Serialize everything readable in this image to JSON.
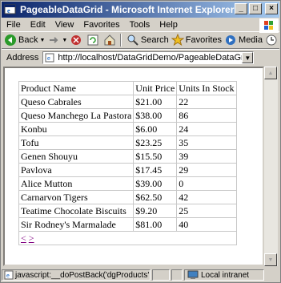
{
  "window": {
    "title": "PageableDataGrid - Microsoft Internet Explorer"
  },
  "menu": [
    "File",
    "Edit",
    "View",
    "Favorites",
    "Tools",
    "Help"
  ],
  "menu_accel": [
    "F",
    "E",
    "V",
    "a",
    "T",
    "H"
  ],
  "toolbar": {
    "back": "Back",
    "search": "Search",
    "favorites": "Favorites",
    "media": "Media"
  },
  "address": {
    "label": "Address",
    "url": "http://localhost/DataGridDemo/PageableDataGrid.aspx"
  },
  "grid": {
    "headers": [
      "Product Name",
      "Unit Price",
      "Units In Stock"
    ],
    "rows": [
      [
        "Queso Cabrales",
        "$21.00",
        "22"
      ],
      [
        "Queso Manchego La Pastora",
        "$38.00",
        "86"
      ],
      [
        "Konbu",
        "$6.00",
        "24"
      ],
      [
        "Tofu",
        "$23.25",
        "35"
      ],
      [
        "Genen Shouyu",
        "$15.50",
        "39"
      ],
      [
        "Pavlova",
        "$17.45",
        "29"
      ],
      [
        "Alice Mutton",
        "$39.00",
        "0"
      ],
      [
        "Carnarvon Tigers",
        "$62.50",
        "42"
      ],
      [
        "Teatime Chocolate Biscuits",
        "$9.20",
        "25"
      ],
      [
        "Sir Rodney's Marmalade",
        "$81.00",
        "40"
      ]
    ],
    "pager_prev": "<",
    "pager_next": ">"
  },
  "status": {
    "text": "javascript:__doPostBack('dgProducts'",
    "zone": "Local intranet"
  },
  "colors": {
    "titlebar_start": "#0a246a",
    "titlebar_end": "#a6caf0",
    "link_visited": "#800080"
  }
}
